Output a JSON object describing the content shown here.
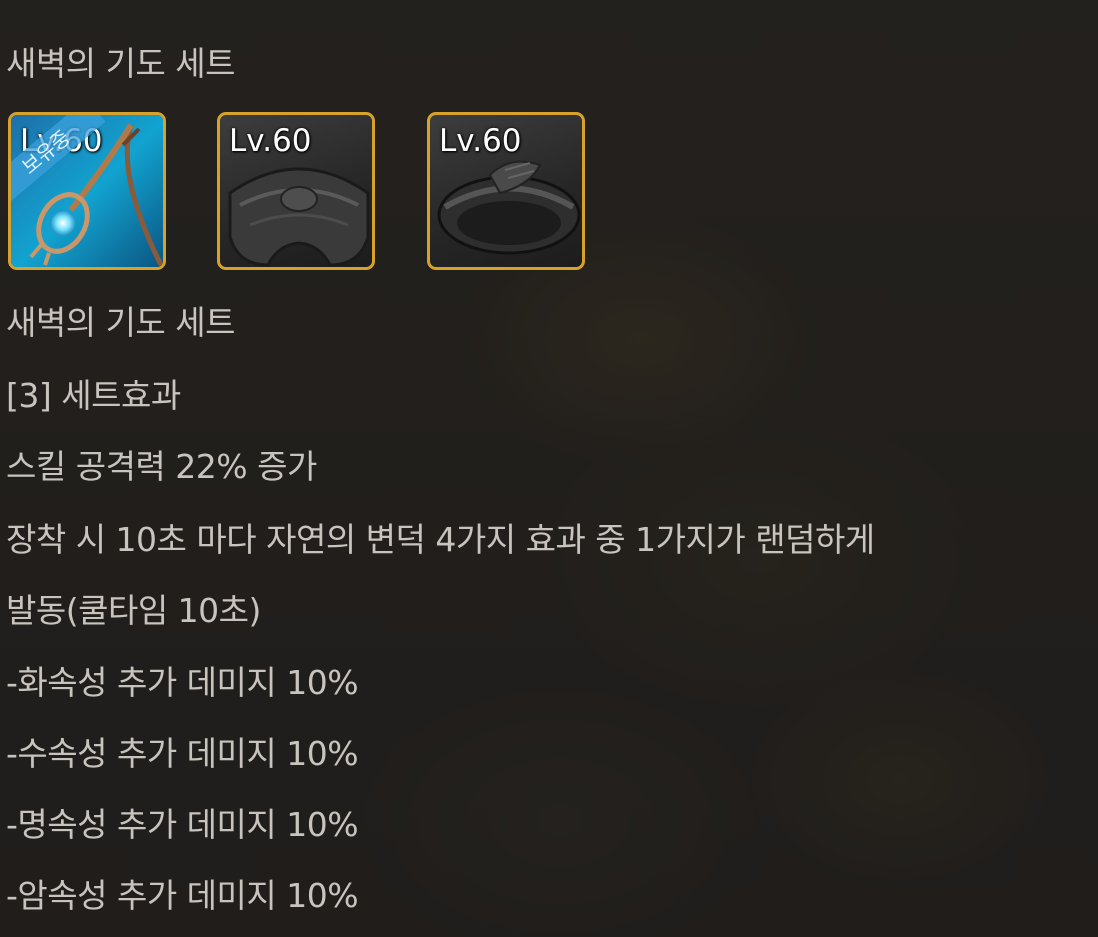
{
  "set": {
    "header_title": "새벽의 기도 세트",
    "items": [
      {
        "level": "Lv.60",
        "ribbon": "보유중",
        "icon": "staff-icon"
      },
      {
        "level": "Lv.60",
        "icon": "ring-icon"
      },
      {
        "level": "Lv.60",
        "icon": "bracelet-icon"
      }
    ],
    "name": "새벽의 기도 세트",
    "effect_header": "[3] 세트효과",
    "effects": [
      "스킬 공격력 22% 증가",
      "장착 시 10초 마다 자연의 변덕 4가지 효과 중 1가지가 랜덤하게",
      "발동(쿨타임 10초)",
      "-화속성 추가 데미지 10%",
      "-수속성 추가 데미지 10%",
      "-명속성 추가 데미지 10%",
      "-암속성 추가 데미지 10%"
    ]
  },
  "colors": {
    "frame_gold": "#d6a22c",
    "text": "#c8c4bd"
  }
}
